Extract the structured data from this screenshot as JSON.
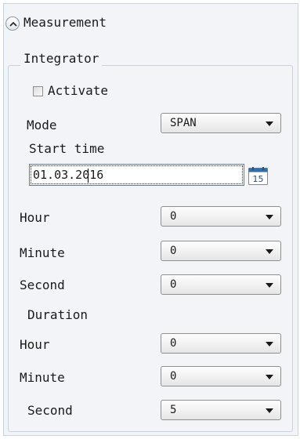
{
  "header": {
    "title": "Measurement",
    "collapse_icon": "chevron-up-icon"
  },
  "integrator": {
    "title": "Integrator",
    "activate": {
      "label": "Activate",
      "checked": false
    },
    "mode": {
      "label": "Mode",
      "value": "SPAN"
    },
    "start_time": {
      "label": "Start time",
      "date_value": "01.03.2016",
      "calendar_icon": "calendar-icon",
      "calendar_day": "15"
    },
    "start_hour": {
      "label": "Hour",
      "value": "0"
    },
    "start_minute": {
      "label": "Minute",
      "value": "0"
    },
    "start_second": {
      "label": "Second",
      "value": "0"
    },
    "duration": {
      "label": "Duration",
      "hour": {
        "label": "Hour",
        "value": "0"
      },
      "minute": {
        "label": "Minute",
        "value": "0"
      },
      "second": {
        "label": "Second",
        "value": "5"
      }
    }
  }
}
